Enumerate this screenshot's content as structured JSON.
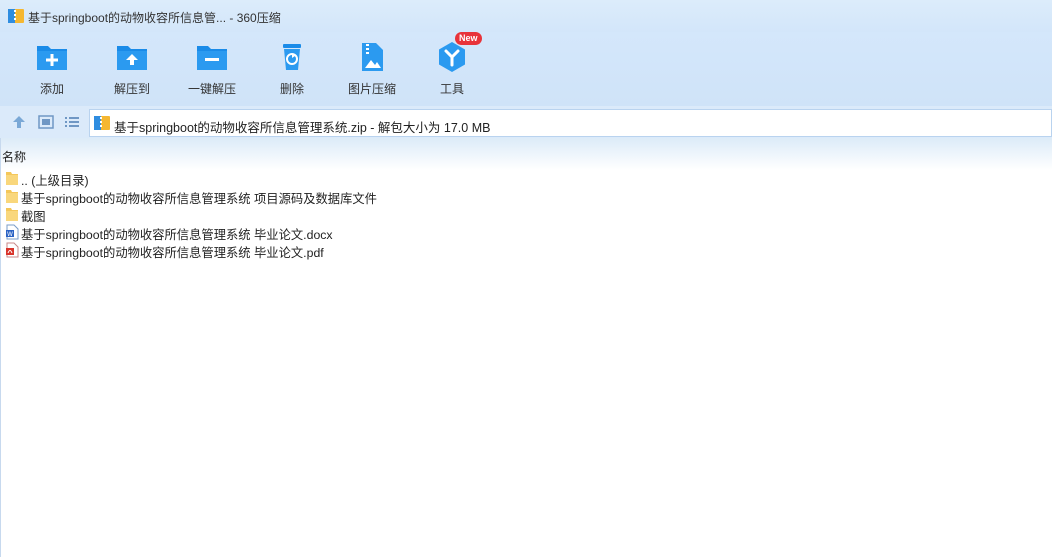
{
  "window": {
    "title": "基于springboot的动物收容所信息管... - 360压缩"
  },
  "toolbar": {
    "items": [
      {
        "label": "添加",
        "icon": "add-folder-icon"
      },
      {
        "label": "解压到",
        "icon": "extract-to-icon"
      },
      {
        "label": "一键解压",
        "icon": "one-click-extract-icon"
      },
      {
        "label": "删除",
        "icon": "delete-bin-icon"
      },
      {
        "label": "图片压缩",
        "icon": "image-compress-icon"
      },
      {
        "label": "工具",
        "icon": "tools-icon",
        "badge": "New"
      }
    ]
  },
  "address": {
    "path": "基于springboot的动物收容所信息管理系统.zip - 解包大小为 17.0 MB"
  },
  "columns": {
    "name": "名称"
  },
  "files": [
    {
      "name": ".. (上级目录)",
      "type": "folder"
    },
    {
      "name": "基于springboot的动物收容所信息管理系统 项目源码及数据库文件",
      "type": "folder"
    },
    {
      "name": "截图",
      "type": "folder"
    },
    {
      "name": "基于springboot的动物收容所信息管理系统 毕业论文.docx",
      "type": "docx"
    },
    {
      "name": "基于springboot的动物收容所信息管理系统 毕业论文.pdf",
      "type": "pdf"
    }
  ],
  "colors": {
    "accent": "#1a8be8",
    "titlebar": "#d3e6fa",
    "badge": "#e8333a"
  }
}
